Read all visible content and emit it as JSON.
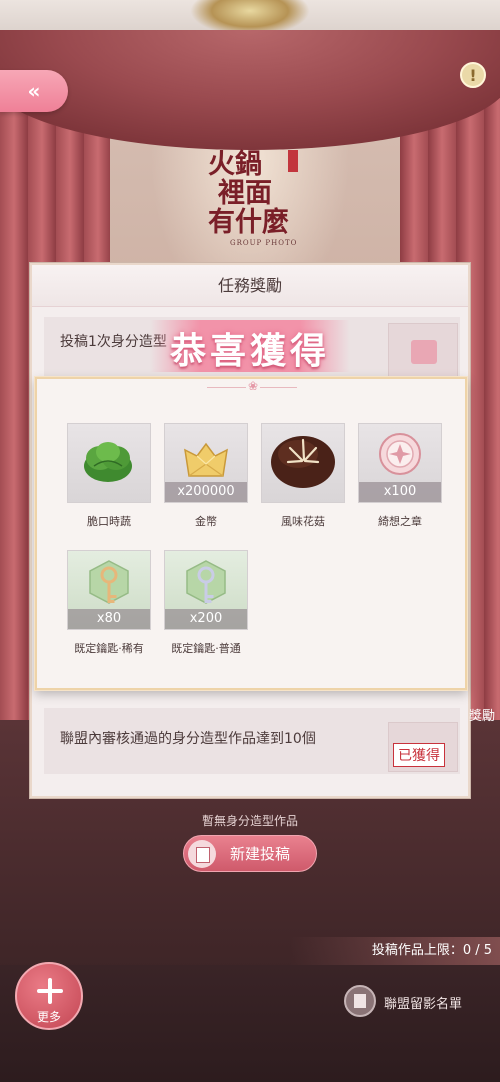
{
  "game_logo": {
    "lines": [
      "火鍋",
      "裡面",
      "有什麼"
    ],
    "subtitle": "GROUP PHOTO"
  },
  "header": {
    "back_glyph": "«",
    "info_glyph": "!"
  },
  "task_panel": {
    "title": "任務獎勵",
    "rows": [
      {
        "text": "投稿1次身分造型"
      },
      {
        "text": "聯盟內審核通過的身分造型作品達到10個",
        "status": "已獲得"
      }
    ]
  },
  "congrats": {
    "title": "恭喜獲得"
  },
  "rewards": [
    {
      "name": "脆口時蔬",
      "qty": "",
      "icon": "lettuce-icon"
    },
    {
      "name": "金幣",
      "qty": "x200000",
      "icon": "gold-coin-icon"
    },
    {
      "name": "風味花菇",
      "qty": "",
      "icon": "mushroom-icon"
    },
    {
      "name": "綺想之章",
      "qty": "x100",
      "icon": "badge-icon"
    },
    {
      "name": "既定鑰匙·稀有",
      "qty": "x80",
      "icon": "rare-key-icon"
    },
    {
      "name": "既定鑰匙·普通",
      "qty": "x200",
      "icon": "common-key-icon"
    }
  ],
  "side_reward_label": "獎勵",
  "empty_message": "暫無身分造型作品",
  "new_post_button": "新建投稿",
  "submission_limit": "投稿作品上限：0 / 5",
  "more_button": "更多",
  "roster_button": "聯盟留影名單",
  "colors": {
    "accent_pink": "#ef8097",
    "curtain_red": "#a34d53",
    "logo_red": "#7a1f28",
    "obtained_red": "#c8323c"
  }
}
